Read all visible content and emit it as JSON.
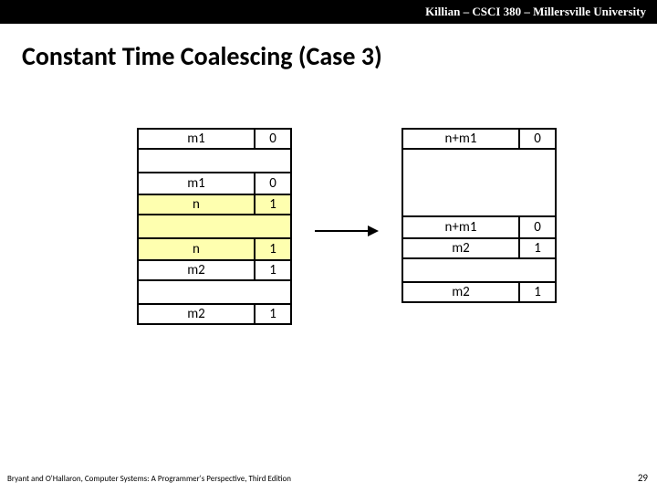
{
  "header": "Killian – CSCI 380 – Millersville University",
  "title": "Constant Time Coalescing (Case 3)",
  "left": {
    "r0": {
      "size": "m1",
      "alloc": "0"
    },
    "r1": {
      "size": "m1",
      "alloc": "0"
    },
    "r2": {
      "size": "n",
      "alloc": "1"
    },
    "r3": {
      "size": "n",
      "alloc": "1"
    },
    "r4": {
      "size": "m2",
      "alloc": "1"
    },
    "r5": {
      "size": "m2",
      "alloc": "1"
    }
  },
  "right": {
    "r0": {
      "size": "n+m1",
      "alloc": "0"
    },
    "r1": {
      "size": "n+m1",
      "alloc": "0"
    },
    "r2": {
      "size": "m2",
      "alloc": "1"
    },
    "r3": {
      "size": "m2",
      "alloc": "1"
    }
  },
  "footer": "Bryant and O'Hallaron, Computer Systems: A Programmer's Perspective, Third Edition",
  "page": "29"
}
